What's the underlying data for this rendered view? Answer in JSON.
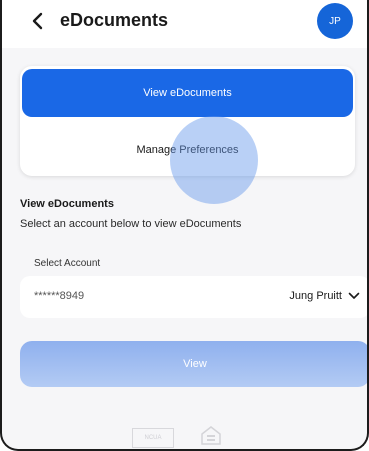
{
  "header": {
    "title": "eDocuments",
    "avatar_initials": "JP",
    "back_icon": "chevron-left-icon"
  },
  "actions": {
    "view_edocuments_label": "View eDocuments",
    "manage_preferences_label": "Manage Preferences"
  },
  "section": {
    "title": "View eDocuments",
    "description": "Select an account below to view eDocuments"
  },
  "account_select": {
    "label": "Select Account",
    "account_number": "******8949",
    "account_name": "Jung Pruitt"
  },
  "view_button": {
    "label": "View"
  },
  "footer": {
    "logo_text": "NCUA"
  },
  "colors": {
    "accent": "#1a68e6",
    "avatar": "#1565d8",
    "view_button_disabled": "#a3bff2",
    "background": "#f6f6f8"
  }
}
